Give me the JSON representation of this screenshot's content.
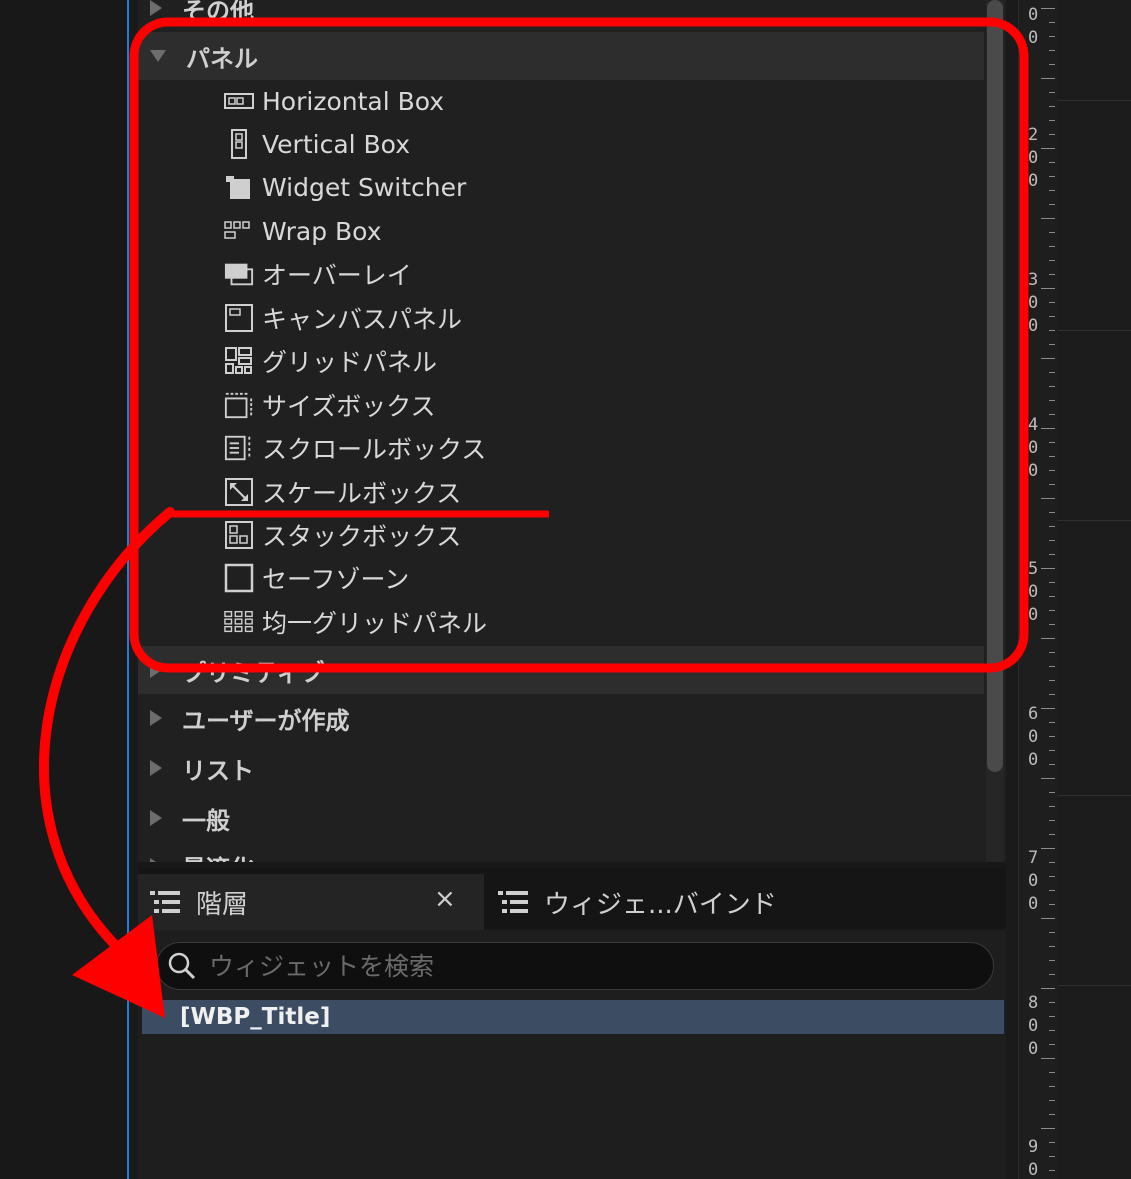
{
  "palette": {
    "categories_top": [
      {
        "label": "その他",
        "expanded": false
      },
      {
        "label": "パネル",
        "expanded": true
      }
    ],
    "panel_items": [
      {
        "label": "Horizontal Box",
        "icon": "horizontal-box-icon"
      },
      {
        "label": "Vertical Box",
        "icon": "vertical-box-icon"
      },
      {
        "label": "Widget Switcher",
        "icon": "widget-switcher-icon"
      },
      {
        "label": "Wrap Box",
        "icon": "wrap-box-icon"
      },
      {
        "label": "オーバーレイ",
        "icon": "overlay-icon"
      },
      {
        "label": "キャンバスパネル",
        "icon": "canvas-panel-icon"
      },
      {
        "label": "グリッドパネル",
        "icon": "grid-panel-icon"
      },
      {
        "label": "サイズボックス",
        "icon": "size-box-icon"
      },
      {
        "label": "スクロールボックス",
        "icon": "scroll-box-icon"
      },
      {
        "label": "スケールボックス",
        "icon": "scale-box-icon"
      },
      {
        "label": "スタックボックス",
        "icon": "stack-box-icon"
      },
      {
        "label": "セーフゾーン",
        "icon": "safe-zone-icon"
      },
      {
        "label": "均一グリッドパネル",
        "icon": "uniform-grid-panel-icon"
      }
    ],
    "categories_bottom": [
      {
        "label": "プリミティブ",
        "expanded": false
      },
      {
        "label": "ユーザーが作成",
        "expanded": false
      },
      {
        "label": "リスト",
        "expanded": false
      },
      {
        "label": "一般",
        "expanded": false
      },
      {
        "label": "最適化",
        "expanded": false
      }
    ]
  },
  "hierarchy": {
    "tab_label": "階層",
    "close_label": "×",
    "other_tab_label": "ウィジェ...バインド",
    "search_placeholder": "ウィジェットを検索",
    "root_item": "[WBP_Title]"
  },
  "ruler": {
    "labels": [
      "0",
      "0",
      "2",
      "0",
      "0",
      "3",
      "0",
      "0",
      "4",
      "0",
      "0",
      "5",
      "0",
      "0",
      "6",
      "0",
      "0",
      "7",
      "0",
      "0",
      "8",
      "0",
      "0",
      "9",
      "0"
    ]
  },
  "colors": {
    "annotation_red": "#ff0000",
    "selection_blue": "#3c4d63",
    "guide_blue": "#1f7fd6"
  }
}
